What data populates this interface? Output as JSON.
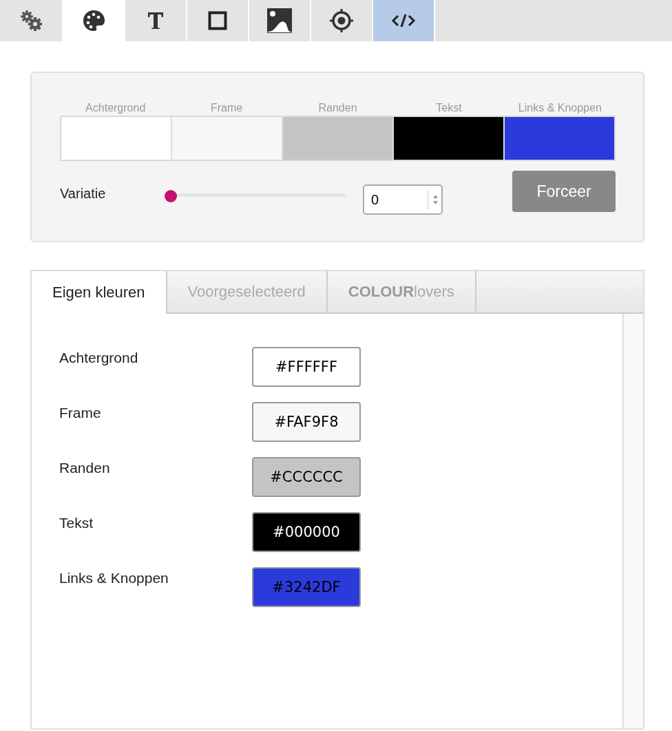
{
  "toolbar": {
    "tabs": [
      {
        "selected": false,
        "highlighted": false
      },
      {
        "selected": true,
        "highlighted": false
      },
      {
        "selected": false,
        "highlighted": false
      },
      {
        "selected": false,
        "highlighted": false
      },
      {
        "selected": false,
        "highlighted": false
      },
      {
        "selected": false,
        "highlighted": false
      },
      {
        "selected": false,
        "highlighted": true
      }
    ]
  },
  "palette": {
    "swatches": [
      {
        "label": "Achtergrond",
        "color": "#ffffff"
      },
      {
        "label": "Frame",
        "color": "#f8f7f6"
      },
      {
        "label": "Randen",
        "color": "#c4c4c4"
      },
      {
        "label": "Tekst",
        "color": "#000000"
      },
      {
        "label": "Links & Knoppen",
        "color": "#2b3adb"
      }
    ],
    "variation": {
      "label": "Variatie",
      "level": 0,
      "value": "0"
    },
    "force_button": "Forceer"
  },
  "color_tabs": [
    {
      "label": "Eigen kleuren",
      "selected": true
    },
    {
      "label": "Voorgeselecteerd",
      "selected": false
    },
    {
      "label": "**COLOUR**lovers",
      "selected": false
    }
  ],
  "colors": [
    {
      "label": "Achtergrond",
      "value": "#FFFFFF",
      "color": "#ffffff"
    },
    {
      "label": "Frame",
      "value": "#FAF9F8",
      "color": "#f8f7f6"
    },
    {
      "label": "Randen",
      "value": "#CCCCCC",
      "color": "#c4c4c4"
    },
    {
      "label": "Tekst",
      "value": "#000000",
      "color": "#000000"
    },
    {
      "label": "Links & Knoppen",
      "value": "#3242DF",
      "color": "#2b3adb"
    }
  ]
}
